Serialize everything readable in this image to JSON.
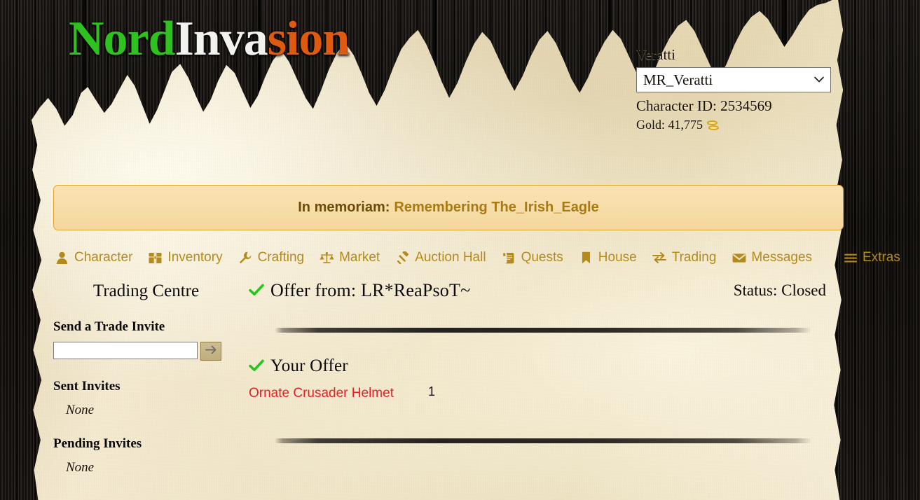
{
  "site": {
    "logo_part1": "Nord",
    "logo_part2": "Inva",
    "logo_part3": "sion",
    "colors": {
      "logo_green": "#2fc11f",
      "logo_white": "#f2f2ee",
      "logo_orange": "#dd5a10",
      "nav_gold": "#b58a1c",
      "item_red": "#ee1c24",
      "check_green": "#22c61f",
      "banner_bg": "#f7dda8",
      "banner_border": "#d8a63a"
    }
  },
  "user": {
    "account_label": "Veratti",
    "character_select_value": "MR_Veratti",
    "character_select_options": [
      "MR_Veratti"
    ],
    "chevron": "⌄",
    "character_id_line": "Character ID: 2534569",
    "gold_line": "Gold: 41,775",
    "gold_icon": "coin-stack-icon"
  },
  "memoriam": {
    "prefix": "In memoriam:",
    "link": "Remembering The_Irish_Eagle"
  },
  "nav": {
    "items": [
      {
        "label": "Character",
        "icon": "user-icon"
      },
      {
        "label": "Inventory",
        "icon": "chest-icon"
      },
      {
        "label": "Crafting",
        "icon": "wrench-icon"
      },
      {
        "label": "Market",
        "icon": "balance-scale-icon"
      },
      {
        "label": "Auction Hall",
        "icon": "gavel-icon"
      },
      {
        "label": "Quests",
        "icon": "scroll-icon"
      },
      {
        "label": "House",
        "icon": "bookmark-icon"
      },
      {
        "label": "Trading",
        "icon": "exchange-icon"
      },
      {
        "label": "Messages",
        "icon": "envelope-icon"
      }
    ],
    "extras": {
      "label": "Extras",
      "icon": "hamburger-icon"
    }
  },
  "sidebar": {
    "title": "Trading Centre",
    "send_invite_heading": "Send a Trade Invite",
    "invite_input_value": "",
    "invite_input_placeholder": "",
    "invite_submit_icon": "→",
    "sent_invites_heading": "Sent Invites",
    "sent_invites_empty": "None",
    "pending_invites_heading": "Pending Invites",
    "pending_invites_empty": "None"
  },
  "trade": {
    "offer_from_title": "Offer from: LR*ReaPsoT~",
    "offer_from_check": "check-icon",
    "status": "Status: Closed",
    "your_offer_title": "Your Offer",
    "your_offer_check": "check-icon",
    "your_offer_items": [
      {
        "name": "Ornate Crusader Helmet",
        "qty": "1"
      }
    ]
  }
}
